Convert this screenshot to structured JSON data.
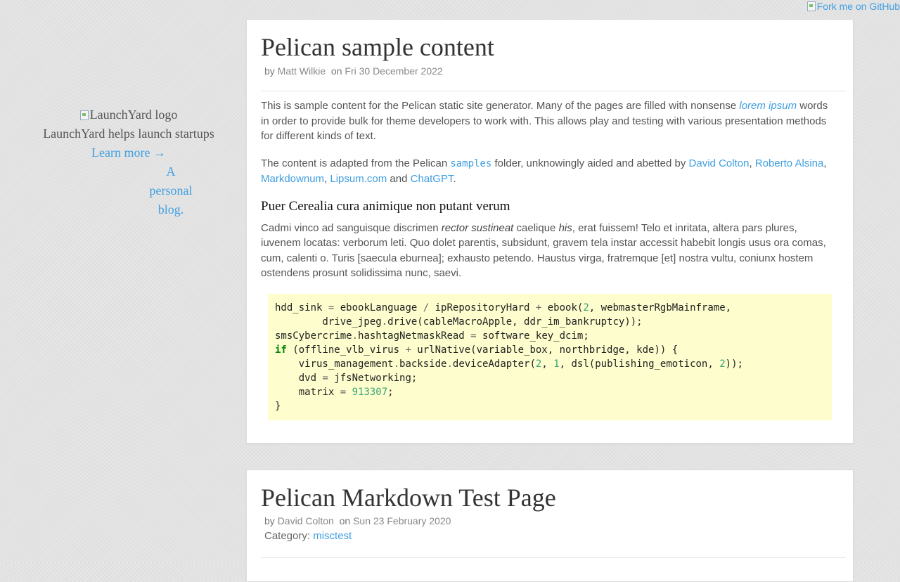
{
  "fork": {
    "label": "Fork me on GitHub"
  },
  "sidebar": {
    "logo_alt": "LaunchYard logo",
    "promo": "LaunchYard helps launch startups",
    "learn_more": "Learn more →",
    "tagline_1": "A",
    "tagline_2": "personal",
    "tagline_3": "blog."
  },
  "post1": {
    "title": "Pelican sample content",
    "by_label": "by",
    "author": "Matt Wilkie",
    "on_label": "on",
    "date": "Fri 30 December 2022",
    "p1_a": "This is sample content for the Pelican static site generator. Many of the pages are filled with nonsense ",
    "p1_link": "lorem ipsum",
    "p1_b": " words in order to provide bulk for theme developers to work with. This allows play and testing with various presentation methods for different kinds of text.",
    "p2_a": "The content is adapted from the Pelican ",
    "p2_code": "samples",
    "p2_b": " folder, unknowingly aided and abetted by ",
    "link_colton": "David Colton",
    "comma1": ",",
    "link_alsina": "Roberto Alsina",
    "comma2": ",",
    "link_markdownum": "Markdownum",
    "comma3": ",",
    "link_lipsum": "Lipsum.com",
    "and_label": "and",
    "link_chatgpt": "ChatGPT",
    "period": ".",
    "heading": "Puer Cerealia cura animique non putant verum",
    "p3_a": "Cadmi vinco ad sanguisque discrimen ",
    "p3_em1": "rector sustineat",
    "p3_b": " caelique ",
    "p3_em2": "his",
    "p3_c": ", erat fuissem! Telo et inritata, altera pars plures, iuvenem locatas: verborum leti. Quo dolet parentis, subsidunt, gravem tela instar accessit habebit longis usus ora comas, cum, calenti o. Turis [saecula eburnea]; exhausto petendo. Haustus virga, fratremque [et] nostra vultu, coniunx hostem ostendens prosunt solidissima nunc, saevi."
  },
  "code": {
    "l1_a": "hdd_sink ",
    "l1_op1": "=",
    "l1_b": " ebookLanguage ",
    "l1_op2": "/",
    "l1_c": " ipRepositoryHard ",
    "l1_op3": "+",
    "l1_d": " ebook(",
    "l1_n1": "2",
    "l1_e": ", webmasterRgbMainframe,",
    "l2_a": "        drive_jpeg",
    "l2_dot": ".",
    "l2_b": "drive(cableMacroApple, ddr_im_bankruptcy));",
    "l3_a": "smsCybercrime",
    "l3_dot": ".",
    "l3_b": "hashtagNetmaskRead ",
    "l3_op": "=",
    "l3_c": " software_key_dcim;",
    "l4_kw": "if",
    "l4_a": " (offline_vlb_virus ",
    "l4_op": "+",
    "l4_b": " urlNative(variable_box, northbridge, kde)) {",
    "l5_a": "    virus_management",
    "l5_dot1": ".",
    "l5_b": "backside",
    "l5_dot2": ".",
    "l5_c": "deviceAdapter(",
    "l5_n1": "2",
    "l5_d": ", ",
    "l5_n2": "1",
    "l5_e": ", dsl(publishing_emoticon, ",
    "l5_n3": "2",
    "l5_f": "));",
    "l6_a": "    dvd ",
    "l6_op": "=",
    "l6_b": " jfsNetworking;",
    "l7_a": "    matrix ",
    "l7_op": "=",
    "l7_sp": " ",
    "l7_n": "913307",
    "l7_b": ";",
    "l8": "}"
  },
  "post2": {
    "title": "Pelican Markdown Test Page",
    "by_label": "by",
    "author": "David Colton",
    "on_label": "on",
    "date": "Sun 23 February 2020",
    "category_label": "Category:",
    "category": "misctest"
  }
}
